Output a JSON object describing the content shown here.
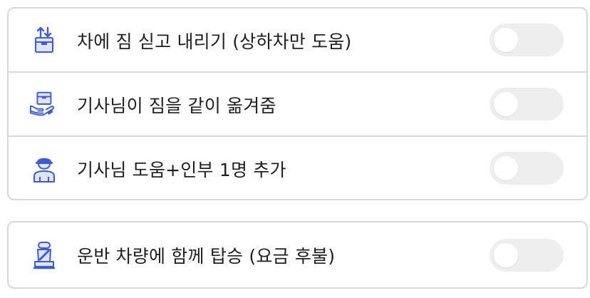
{
  "group1": {
    "items": [
      {
        "label": "차에 짐 싣고 내리기 (상하차만 도움)",
        "icon": "box-updown-icon",
        "enabled": false
      },
      {
        "label": "기사님이 짐을 같이 옮겨줌",
        "icon": "hand-box-icon",
        "enabled": false
      },
      {
        "label": "기사님 도움+인부 1명 추가",
        "icon": "worker-icon",
        "enabled": false
      }
    ]
  },
  "group2": {
    "items": [
      {
        "label": "운반 차량에 함께 탑승 (요금 후불)",
        "icon": "seat-icon",
        "enabled": false
      }
    ]
  },
  "colors": {
    "icon_blue": "#3b5bdb",
    "icon_fill": "#dfe5ff",
    "toggle_off": "#eeeeee",
    "border": "#d7d8dc"
  }
}
